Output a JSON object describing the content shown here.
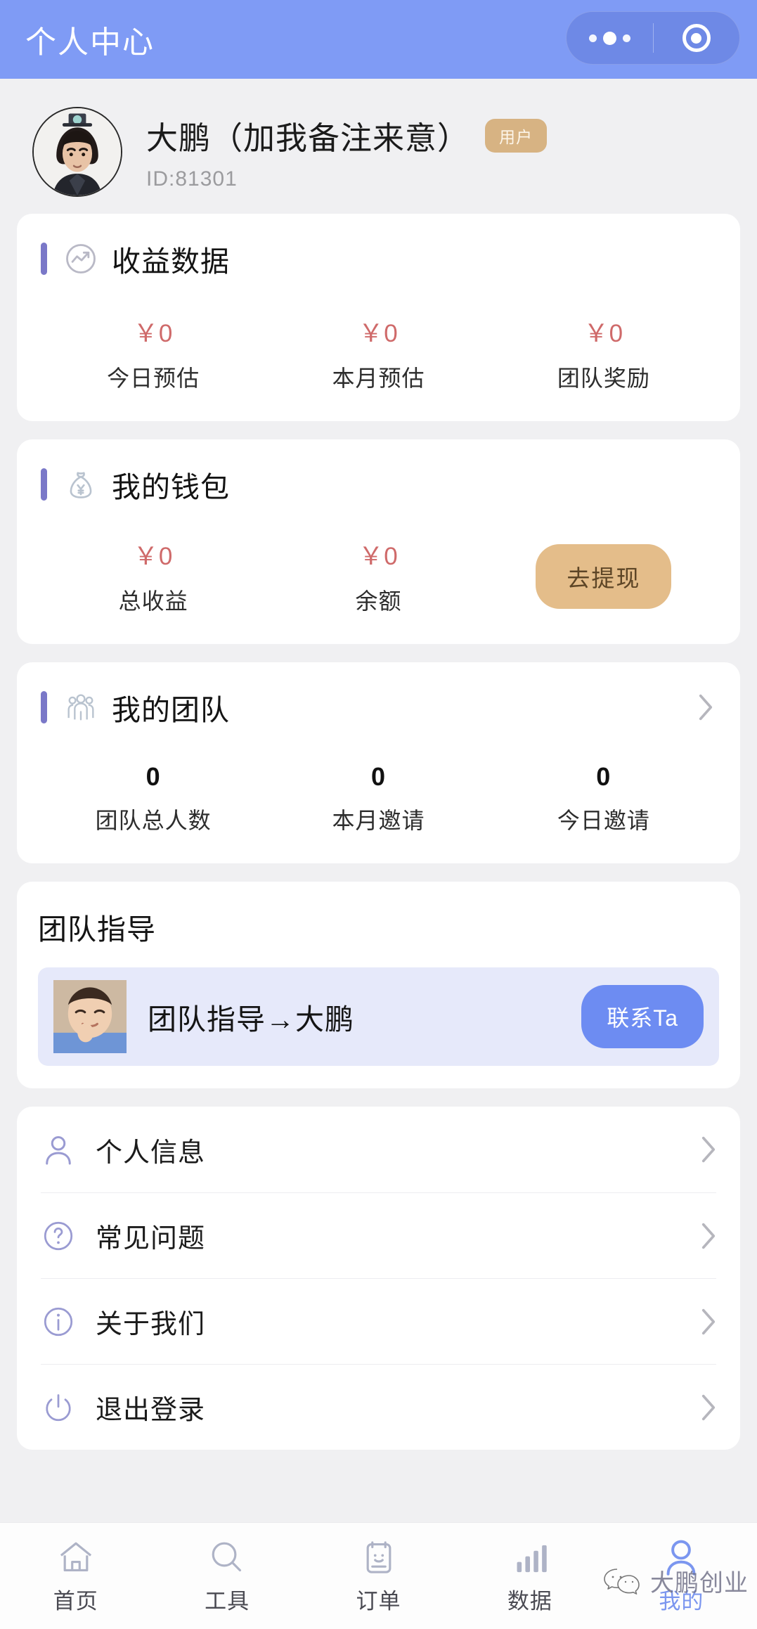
{
  "header": {
    "title": "个人中心",
    "capsule": {
      "more_icon": "more-dots-icon",
      "target_icon": "target-icon"
    }
  },
  "profile": {
    "name": "大鹏（加我备注来意）",
    "badge": "用户",
    "id": "ID:81301"
  },
  "income_card": {
    "icon": "trending-up-icon",
    "title": "收益数据",
    "stats": [
      {
        "value": "￥0",
        "label": "今日预估"
      },
      {
        "value": "￥0",
        "label": "本月预估"
      },
      {
        "value": "￥0",
        "label": "团队奖励"
      }
    ]
  },
  "wallet_card": {
    "icon": "money-bag-icon",
    "title": "我的钱包",
    "stats": [
      {
        "value": "￥0",
        "label": "总收益"
      },
      {
        "value": "￥0",
        "label": "余额"
      }
    ],
    "withdraw_label": "去提现"
  },
  "team_card": {
    "icon": "group-people-icon",
    "title": "我的团队",
    "stats": [
      {
        "value": "0",
        "label": "团队总人数"
      },
      {
        "value": "0",
        "label": "本月邀请"
      },
      {
        "value": "0",
        "label": "今日邀请"
      }
    ]
  },
  "guidance_card": {
    "title": "团队指导",
    "entry_name": "团队指导→大鹏",
    "contact_label": "联系Ta"
  },
  "menu": {
    "items": [
      {
        "icon": "person-icon",
        "label": "个人信息"
      },
      {
        "icon": "question-icon",
        "label": "常见问题"
      },
      {
        "icon": "info-icon",
        "label": "关于我们"
      },
      {
        "icon": "power-icon",
        "label": "退出登录"
      }
    ]
  },
  "tabbar": {
    "items": [
      {
        "icon": "home-icon",
        "label": "首页",
        "active": false
      },
      {
        "icon": "search-icon",
        "label": "工具",
        "active": false
      },
      {
        "icon": "clipboard-icon",
        "label": "订单",
        "active": false
      },
      {
        "icon": "bar-chart-icon",
        "label": "数据",
        "active": false
      },
      {
        "icon": "user-icon",
        "label": "我的",
        "active": true
      }
    ]
  },
  "watermark": {
    "logo": "wechat-icon",
    "text": "大鹏创业"
  },
  "colors": {
    "header_bg": "#7f9bf5",
    "page_bg": "#f0f0f2",
    "accent_purple": "#7a78c8",
    "money_red": "#cf6a6a",
    "withdraw_tan": "#e4bd8a",
    "contact_blue": "#6d8cf2",
    "badge_tan": "#d7b383"
  }
}
